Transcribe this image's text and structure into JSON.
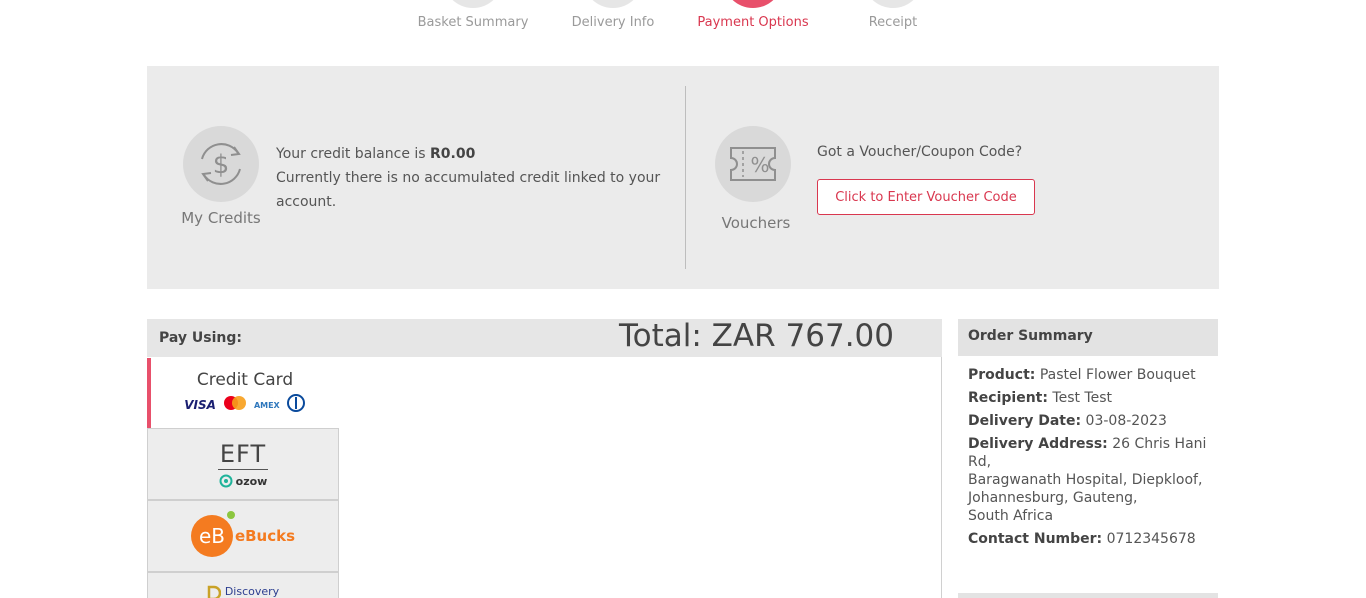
{
  "steps": [
    {
      "label": "Basket Summary",
      "active": false
    },
    {
      "label": "Delivery Info",
      "active": false
    },
    {
      "label": "Payment Options",
      "active": true
    },
    {
      "label": "Receipt",
      "active": false
    }
  ],
  "credits": {
    "caption": "My Credits",
    "balance_prefix": "Your credit balance is",
    "balance_value": "R0.00",
    "note": "Currently there is no accumulated credit linked to your account."
  },
  "vouchers": {
    "caption": "Vouchers",
    "question": "Got a Voucher/Coupon Code?",
    "button_label": "Click to Enter Voucher Code"
  },
  "payment": {
    "title": "Pay Using:",
    "total": "Total: ZAR 767.00",
    "methods": {
      "credit_card": "Credit Card",
      "visa": "VISA",
      "amex": "AMEX",
      "eft": "EFT",
      "ozow": "ozow",
      "ebucks_mark": "eB",
      "ebucks_text": "eBucks",
      "discovery": "Discovery"
    }
  },
  "summary": {
    "title": "Order Summary",
    "product_label": "Product:",
    "product": "Pastel Flower Bouquet",
    "recipient_label": "Recipient:",
    "recipient": "Test Test",
    "date_label": "Delivery Date:",
    "date": "03-08-2023",
    "address_label": "Delivery Address:",
    "address_line1": "26 Chris Hani Rd,",
    "address_line2": "Baragwanath Hospital, Diepkloof,",
    "address_line3": "Johannesburg, Gauteng,",
    "address_line4": "South Africa",
    "contact_label": "Contact Number:",
    "contact": "0712345678"
  },
  "colors": {
    "accent": "#e8506b",
    "accent_text": "#d9374f",
    "panel_bg": "#ebebeb"
  }
}
